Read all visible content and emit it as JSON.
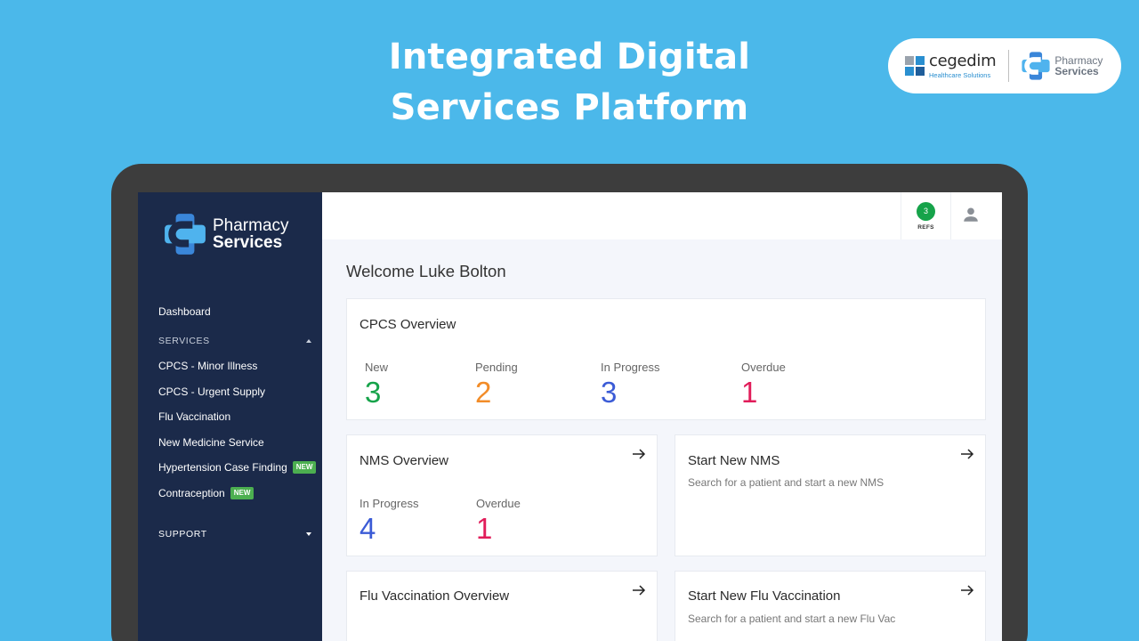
{
  "hero": {
    "line1": "Integrated Digital",
    "line2": "Services Platform"
  },
  "partner": {
    "name": "cegedim",
    "subtitle": "Healthcare Solutions"
  },
  "app": {
    "brand_line1": "Pharmacy",
    "brand_line2": "Services"
  },
  "sidebar": {
    "dashboard": "Dashboard",
    "services_header": "SERVICES",
    "items": [
      {
        "label": "CPCS - Minor Illness",
        "badge": ""
      },
      {
        "label": "CPCS - Urgent Supply",
        "badge": ""
      },
      {
        "label": "Flu Vaccination",
        "badge": ""
      },
      {
        "label": "New Medicine Service",
        "badge": ""
      },
      {
        "label": "Hypertension Case Finding",
        "badge": "NEW"
      },
      {
        "label": "Contraception",
        "badge": "NEW"
      }
    ],
    "support_header": "SUPPORT"
  },
  "topbar": {
    "refs_count": "3",
    "refs_label": "REFS"
  },
  "main": {
    "welcome": "Welcome Luke Bolton",
    "cpcs": {
      "title": "CPCS Overview",
      "stats": [
        {
          "label": "New",
          "value": "3",
          "color": "#16A34A"
        },
        {
          "label": "Pending",
          "value": "2",
          "color": "#F28C28"
        },
        {
          "label": "In Progress",
          "value": "3",
          "color": "#3B5BD6"
        },
        {
          "label": "Overdue",
          "value": "1",
          "color": "#E11D5A"
        }
      ]
    },
    "nms": {
      "title": "NMS Overview",
      "stats": [
        {
          "label": "In Progress",
          "value": "4",
          "color": "#3B5BD6"
        },
        {
          "label": "Overdue",
          "value": "1",
          "color": "#E11D5A"
        }
      ]
    },
    "start_nms": {
      "title": "Start New NMS",
      "subtitle": "Search for a patient and start a new NMS"
    },
    "flu": {
      "title": "Flu Vaccination Overview"
    },
    "start_flu": {
      "title": "Start New Flu Vaccination",
      "subtitle": "Search for a patient and start a new Flu Vac"
    }
  },
  "colors": {
    "background": "#4BB8EA",
    "sidebar": "#1B2A4A",
    "accent_green": "#16A34A",
    "badge_green": "#4CAF50"
  },
  "icons": [
    "pharmacy-cross-logo-icon",
    "cegedim-logo-icon",
    "user-icon",
    "arrow-right-icon",
    "caret-up-icon",
    "caret-down-icon"
  ]
}
